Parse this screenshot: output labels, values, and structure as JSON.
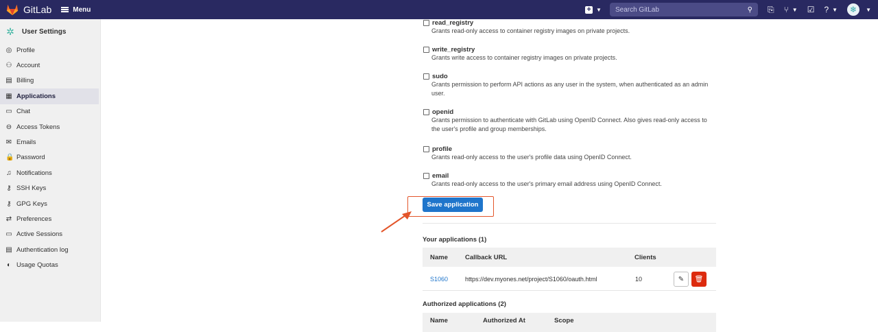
{
  "navbar": {
    "brand": "GitLab",
    "menu_label": "Menu",
    "search_placeholder": "Search GitLab",
    "avatar_glyph": "❄"
  },
  "sidebar": {
    "title": "User Settings",
    "items": [
      {
        "label": "Profile",
        "icon": "profile-icon",
        "glyph": "◎"
      },
      {
        "label": "Account",
        "icon": "account-icon",
        "glyph": "⚇"
      },
      {
        "label": "Billing",
        "icon": "billing-icon",
        "glyph": "▤"
      },
      {
        "label": "Applications",
        "icon": "applications-icon",
        "glyph": "▦",
        "active": true
      },
      {
        "label": "Chat",
        "icon": "chat-icon",
        "glyph": "▭"
      },
      {
        "label": "Access Tokens",
        "icon": "token-icon",
        "glyph": "⊖"
      },
      {
        "label": "Emails",
        "icon": "email-icon",
        "glyph": "✉"
      },
      {
        "label": "Password",
        "icon": "lock-icon",
        "glyph": "🔒"
      },
      {
        "label": "Notifications",
        "icon": "bell-icon",
        "glyph": "♫"
      },
      {
        "label": "SSH Keys",
        "icon": "key-icon",
        "glyph": "⚷"
      },
      {
        "label": "GPG Keys",
        "icon": "key-icon",
        "glyph": "⚷"
      },
      {
        "label": "Preferences",
        "icon": "preferences-icon",
        "glyph": "⇄"
      },
      {
        "label": "Active Sessions",
        "icon": "sessions-icon",
        "glyph": "▭"
      },
      {
        "label": "Authentication log",
        "icon": "log-icon",
        "glyph": "▤"
      },
      {
        "label": "Usage Quotas",
        "icon": "quota-icon",
        "glyph": "◐"
      }
    ]
  },
  "scopes": [
    {
      "name": "read_registry",
      "desc": "Grants read-only access to container registry images on private projects."
    },
    {
      "name": "write_registry",
      "desc": "Grants write access to container registry images on private projects."
    },
    {
      "name": "sudo",
      "desc": "Grants permission to perform API actions as any user in the system, when authenticated as an admin user."
    },
    {
      "name": "openid",
      "desc": "Grants permission to authenticate with GitLab using OpenID Connect. Also gives read-only access to the user's profile and group memberships."
    },
    {
      "name": "profile",
      "desc": "Grants read-only access to the user's profile data using OpenID Connect."
    },
    {
      "name": "email",
      "desc": "Grants read-only access to the user's primary email address using OpenID Connect."
    }
  ],
  "save_button": "Save application",
  "your_apps": {
    "title": "Your applications (1)",
    "headers": {
      "name": "Name",
      "callback": "Callback URL",
      "clients": "Clients"
    },
    "rows": [
      {
        "name": "S1060",
        "callback": "https://dev.myones.net/project/S1060/oauth.html",
        "clients": "10"
      }
    ]
  },
  "authorized_apps": {
    "title": "Authorized applications (2)",
    "headers": {
      "name": "Name",
      "authorized_at": "Authorized At",
      "scope": "Scope"
    }
  },
  "colors": {
    "navbar": "#292961",
    "primary": "#1f75cb",
    "danger": "#dd2b0e",
    "annotation": "#e3552a"
  }
}
